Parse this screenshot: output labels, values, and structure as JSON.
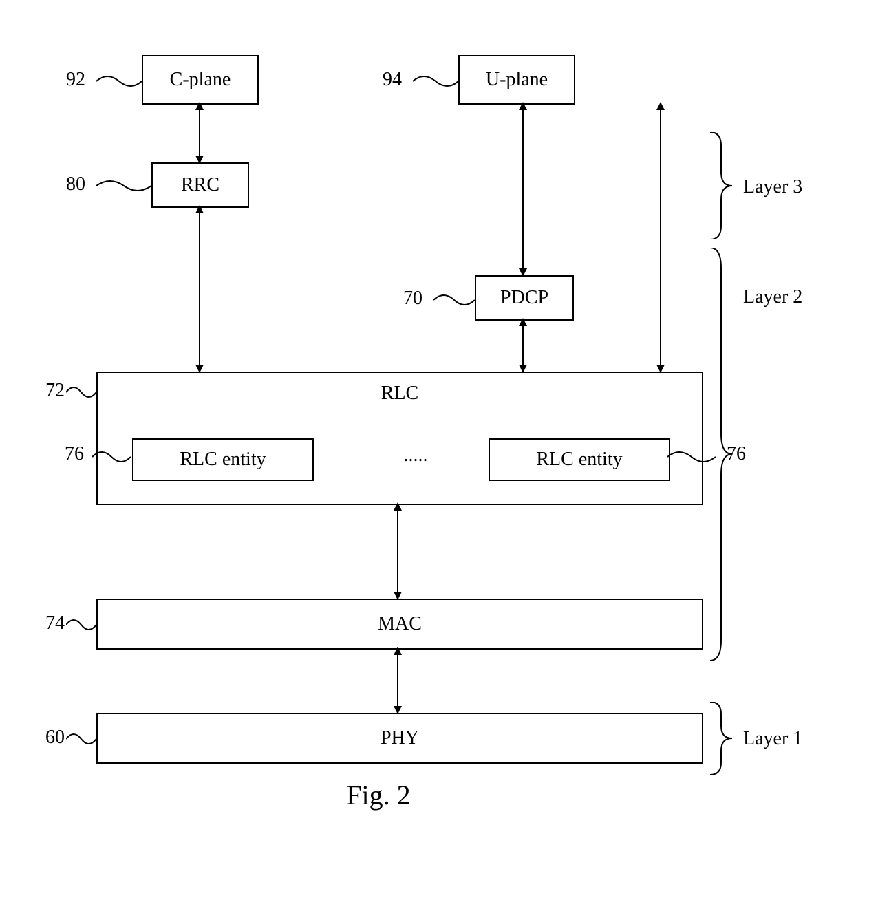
{
  "blocks": {
    "cplane": "C-plane",
    "uplane": "U-plane",
    "rrc": "RRC",
    "pdcp": "PDCP",
    "rlc": "RLC",
    "rlc_entity": "RLC entity",
    "mac": "MAC",
    "phy": "PHY"
  },
  "ellipsis": ".....",
  "refs": {
    "cplane": "92",
    "uplane": "94",
    "rrc": "80",
    "pdcp": "70",
    "rlc": "72",
    "rlc_entity": "76",
    "mac": "74",
    "phy": "60"
  },
  "layers": {
    "l3": "Layer 3",
    "l2": "Layer 2",
    "l1": "Layer 1"
  },
  "caption": "Fig. 2"
}
